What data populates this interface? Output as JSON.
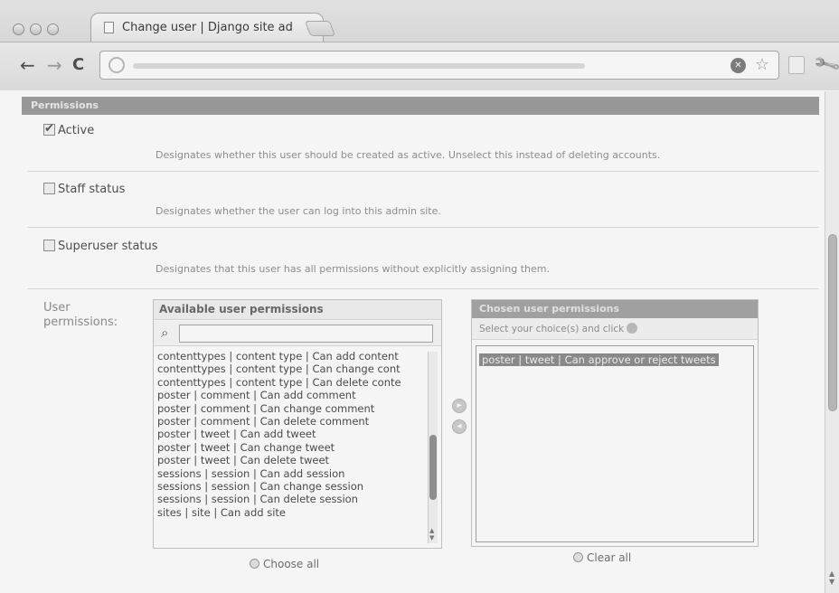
{
  "browser": {
    "tab_title": "Change user | Django site ad",
    "tab_close": "×",
    "nav": {
      "back_icon": "←",
      "forward_icon": "→",
      "reload_icon": "C"
    },
    "stop_icon": "✕",
    "star_icon": "☆",
    "wrench_icon": "🔧"
  },
  "section": {
    "title": "Permissions"
  },
  "fields": {
    "active": {
      "label": "Active",
      "checked": true,
      "help": "Designates whether this user should be created as active. Unselect this instead of deleting accounts."
    },
    "staff": {
      "label": "Staff status",
      "checked": false,
      "help": "Designates whether the user can log into this admin site."
    },
    "superuser": {
      "label": "Superuser status",
      "checked": false,
      "help": "Designates that this user has all permissions without explicitly assigning them."
    }
  },
  "permissions": {
    "label": "User permissions:",
    "available": {
      "title": "Available user permissions",
      "filter_value": "",
      "search_icon": "🔍",
      "options": [
        "contenttypes | content type | Can add content",
        "contenttypes | content type | Can change cont",
        "contenttypes | content type | Can delete conte",
        "poster | comment | Can add comment",
        "poster | comment | Can change comment",
        "poster | comment | Can delete comment",
        "poster | tweet | Can add tweet",
        "poster | tweet | Can change tweet",
        "poster | tweet | Can delete tweet",
        "sessions | session | Can add session",
        "sessions | session | Can change session",
        "sessions | session | Can delete session",
        "sites | site | Can add site"
      ],
      "choose_all": "Choose all"
    },
    "chosen": {
      "title": "Chosen user permissions",
      "help": "Select your choice(s) and click",
      "options": [
        "poster | tweet | Can approve or reject tweets"
      ],
      "clear_all": "Clear all"
    },
    "add_icon": "▸",
    "remove_icon": "◂"
  }
}
